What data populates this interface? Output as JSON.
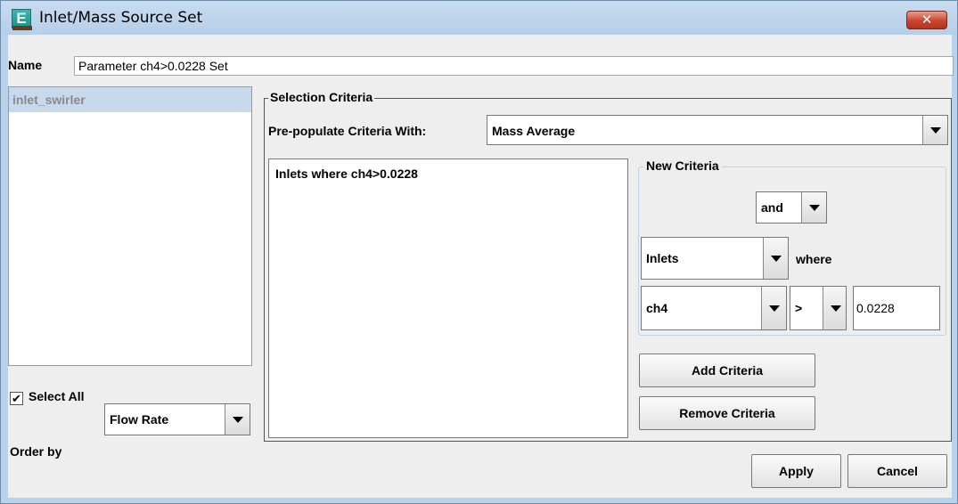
{
  "window": {
    "title": "Inlet/Mass Source Set",
    "app_icon_letter": "E",
    "close_glyph": "✕"
  },
  "name": {
    "label": "Name",
    "value": "Parameter ch4>0.0228 Set"
  },
  "left_list": {
    "items": [
      "inlet_swirler"
    ]
  },
  "select_all": {
    "label": "Select All",
    "checked": true,
    "check_glyph": "✔"
  },
  "order_by": {
    "label": "Order by",
    "selected": "Flow Rate"
  },
  "selection_criteria": {
    "legend": "Selection Criteria",
    "prepopulate_label": "Pre-populate Criteria With:",
    "prepopulate_selected": "Mass Average",
    "criteria_items": [
      "Inlets where ch4>0.0228"
    ]
  },
  "new_criteria": {
    "legend": "New Criteria",
    "conjunction": "and",
    "target": "Inlets",
    "where_label": "where",
    "variable": "ch4",
    "operator": ">",
    "value": "0.0228",
    "add_button": "Add Criteria",
    "remove_button": "Remove Criteria"
  },
  "footer": {
    "apply_button": "Apply",
    "cancel_button": "Cancel"
  },
  "colors": {
    "frame": "#b9d1ea",
    "selected_row": "#c7d9ec",
    "close_button": "#c9452f"
  }
}
